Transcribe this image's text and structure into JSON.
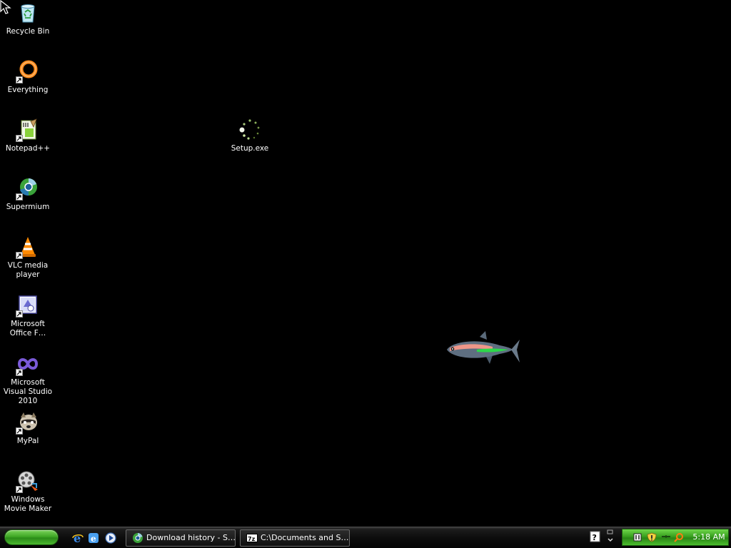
{
  "desktop": {
    "background_color": "#000000",
    "icons": [
      {
        "label": "Recycle Bin",
        "icon": "recycle-bin-icon"
      },
      {
        "label": "Everything",
        "icon": "everything-icon"
      },
      {
        "label": "Notepad++",
        "icon": "notepad-plus-plus-icon"
      },
      {
        "label": "Supermium",
        "icon": "supermium-icon"
      },
      {
        "label": "VLC media player",
        "icon": "vlc-icon"
      },
      {
        "label": "Microsoft Office F…",
        "icon": "office-file-icon"
      },
      {
        "label": "Microsoft Visual Studio 2010",
        "icon": "visual-studio-icon"
      },
      {
        "label": "MyPal",
        "icon": "mypal-icon"
      },
      {
        "label": "Windows Movie Maker",
        "icon": "movie-maker-icon"
      }
    ],
    "setup_icon": {
      "label": "Setup.exe",
      "icon": "loading-spinner-icon"
    }
  },
  "taskbar": {
    "start_icon": "start-button",
    "quick_launch": [
      "internet-explorer-icon",
      "ie-alt-icon",
      "media-player-icon"
    ],
    "tasks": [
      {
        "label": "Download history - S…",
        "icon": "browser-icon"
      },
      {
        "label": "C:\\Documents and S…",
        "icon": "7zip-icon"
      }
    ],
    "tray": {
      "clock": "5:18 AM",
      "icons": [
        "network-icon",
        "security-shield-icon",
        "volume-icon",
        "search-icon"
      ]
    },
    "colors": {
      "start": "#3fa825",
      "tray": "#38a01f"
    }
  }
}
